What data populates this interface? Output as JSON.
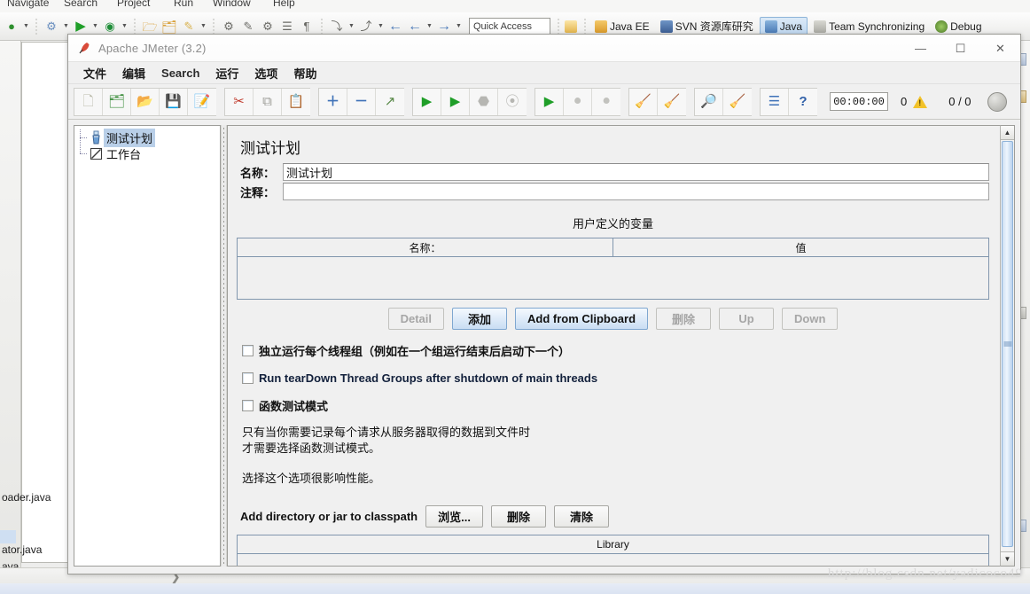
{
  "eclipse": {
    "menubar": [
      {
        "label": "Navigate"
      },
      {
        "label": "Search"
      },
      {
        "label": "Project"
      },
      {
        "label": "Run"
      },
      {
        "label": "Window"
      },
      {
        "label": "Help"
      }
    ],
    "toolbar_icons": [
      {
        "name": "debug-icon",
        "glyph": "⬤"
      },
      {
        "name": "run-icon",
        "glyph": "▶"
      },
      {
        "name": "coverage-icon",
        "glyph": "▶"
      },
      {
        "name": "new-folder-icon",
        "glyph": "🗁"
      },
      {
        "name": "open-folder-icon",
        "glyph": "🗁"
      },
      {
        "name": "edit-pencil-icon",
        "glyph": "✎"
      },
      {
        "name": "pin-icon",
        "glyph": "⚑"
      },
      {
        "name": "brush-icon",
        "glyph": "✒"
      },
      {
        "name": "external-tools-icon",
        "glyph": "⚙"
      },
      {
        "name": "book-icon",
        "glyph": "☰"
      },
      {
        "name": "paragraph-icon",
        "glyph": "¶"
      },
      {
        "name": "next-annotation-icon",
        "glyph": "⤵"
      },
      {
        "name": "previous-annotation-icon",
        "glyph": "⤴"
      },
      {
        "name": "back-icon",
        "glyph": "←"
      },
      {
        "name": "backward-icon",
        "glyph": "←"
      },
      {
        "name": "forward-icon",
        "glyph": "→"
      }
    ],
    "quick_access": {
      "placeholder": "Quick Access",
      "value": "Quick Access"
    },
    "perspectives": [
      {
        "label": "Java EE",
        "icon": "java-ee-icon",
        "active": false
      },
      {
        "label": "SVN 资源库研究",
        "icon": "svn-repository-icon",
        "active": false
      },
      {
        "label": "Java",
        "icon": "java-icon",
        "active": true
      },
      {
        "label": "Team Synchronizing",
        "icon": "team-sync-icon",
        "active": false
      },
      {
        "label": "Debug",
        "icon": "debug-perspective-icon",
        "active": false
      }
    ],
    "background_files": [
      {
        "label": "oader.java"
      },
      {
        "label": "ator.java"
      },
      {
        "label": "ava"
      }
    ]
  },
  "jmeter": {
    "window": {
      "title": "Apache JMeter (3.2)",
      "minimize_label": "—",
      "maximize_label": "☐",
      "close_label": "✕"
    },
    "menus": [
      {
        "label": "文件",
        "name": "menu-file"
      },
      {
        "label": "编辑",
        "name": "menu-edit"
      },
      {
        "label": "Search",
        "name": "menu-search"
      },
      {
        "label": "运行",
        "name": "menu-run"
      },
      {
        "label": "选项",
        "name": "menu-options"
      },
      {
        "label": "帮助",
        "name": "menu-help"
      }
    ],
    "toolbar": {
      "groups": [
        {
          "buttons": [
            {
              "name": "new-test-plan-icon",
              "glyph": "🗋",
              "color": "#c9c9b8"
            },
            {
              "name": "templates-icon",
              "glyph": "🗂",
              "color": "#4f9e4f"
            },
            {
              "name": "open-icon",
              "glyph": "📂",
              "color": "#d9a13b"
            },
            {
              "name": "save-icon",
              "glyph": "💾",
              "color": "#3b3b3b"
            },
            {
              "name": "save-as-icon",
              "glyph": "📝",
              "color": "#4a4a4a"
            }
          ]
        },
        {
          "buttons": [
            {
              "name": "cut-icon",
              "glyph": "✂",
              "color": "#c23b2e"
            },
            {
              "name": "copy-icon",
              "glyph": "⧉",
              "color": "#8a8a84"
            },
            {
              "name": "paste-icon",
              "glyph": "📋",
              "color": "#c09a44"
            }
          ]
        },
        {
          "buttons": [
            {
              "name": "expand-all-icon",
              "glyph": "＋",
              "color": "#3f72b8"
            },
            {
              "name": "collapse-all-icon",
              "glyph": "－",
              "color": "#3f72b8"
            },
            {
              "name": "toggle-icon",
              "glyph": "↗",
              "color": "#5a8a4a"
            }
          ]
        },
        {
          "buttons": [
            {
              "name": "start-icon",
              "glyph": "▶",
              "color": "#1f9e28"
            },
            {
              "name": "start-no-pauses-icon",
              "glyph": "▶",
              "color": "#1f9e28"
            },
            {
              "name": "stop-icon",
              "glyph": "⬣",
              "color": "#b6b6b2"
            },
            {
              "name": "shutdown-icon",
              "glyph": "⊗",
              "color": "#b6b6b2"
            }
          ]
        },
        {
          "buttons": [
            {
              "name": "remote-start-all-icon",
              "glyph": "▶",
              "color": "#1f9e28"
            },
            {
              "name": "remote-stop-all-icon",
              "glyph": "⚫",
              "color": "#b9b9b5"
            },
            {
              "name": "remote-shutdown-all-icon",
              "glyph": "⚫",
              "color": "#b9b9b5"
            }
          ]
        },
        {
          "buttons": [
            {
              "name": "clear-icon",
              "glyph": "🧹",
              "color": "#b08a3e"
            },
            {
              "name": "clear-all-icon",
              "glyph": "🧹",
              "color": "#b08a3e"
            }
          ]
        },
        {
          "buttons": [
            {
              "name": "search-icon",
              "glyph": "🔎",
              "color": "#3a3a38"
            },
            {
              "name": "search-reset-icon",
              "glyph": "🧹",
              "color": "#d6b330"
            }
          ]
        },
        {
          "buttons": [
            {
              "name": "function-helper-icon",
              "glyph": "☰",
              "color": "#3f72b8"
            },
            {
              "name": "help-icon",
              "glyph": "?",
              "color": "#2f5fa8"
            }
          ]
        }
      ],
      "elapsed_time": "00:00:00",
      "warning_count": "0",
      "warning_icon": "warning-triangle-icon",
      "thread_count": "0 / 0",
      "disabled_circle_icon": "remote-engines-icon"
    },
    "tree": {
      "nodes": [
        {
          "label": "测试计划",
          "icon": "test-plan-icon",
          "selected": true
        },
        {
          "label": "工作台",
          "icon": "workbench-icon",
          "selected": false
        }
      ]
    },
    "main": {
      "panel_title": "测试计划",
      "name_label": "名称：",
      "name_value": "测试计划",
      "comment_label": "注释：",
      "comment_value": "",
      "udv_title": "用户定义的变量",
      "udv_columns": [
        "名称：",
        "值"
      ],
      "udv_rows": [],
      "buttons": [
        {
          "label": "Detail",
          "name": "detail-button",
          "state": "disabled"
        },
        {
          "label": "添加",
          "name": "add-button",
          "state": "primary"
        },
        {
          "label": "Add from Clipboard",
          "name": "add-from-clipboard-button",
          "state": "primary"
        },
        {
          "label": "删除",
          "name": "delete-button",
          "state": "disabled"
        },
        {
          "label": "Up",
          "name": "up-button",
          "state": "disabled"
        },
        {
          "label": "Down",
          "name": "down-button",
          "state": "disabled"
        }
      ],
      "checkboxes": [
        {
          "label": "独立运行每个线程组（例如在一个组运行结束后启动下一个）",
          "name": "serialize-thread-groups-checkbox",
          "checked": false,
          "latin": false
        },
        {
          "label": "Run tearDown Thread Groups after shutdown of main threads",
          "name": "run-teardown-checkbox",
          "checked": false,
          "latin": true
        },
        {
          "label": "函数测试模式",
          "name": "functional-test-mode-checkbox",
          "checked": false,
          "latin": false
        }
      ],
      "note_line1": "只有当你需要记录每个请求从服务器取得的数据到文件时",
      "note_line2": "才需要选择函数测试模式。",
      "note_line3": "选择这个选项很影响性能。",
      "classpath_label": "Add directory or jar to classpath",
      "classpath_buttons": [
        {
          "label": "浏览...",
          "name": "browse-button"
        },
        {
          "label": "删除",
          "name": "classpath-delete-button"
        },
        {
          "label": "清除",
          "name": "classpath-clear-button"
        }
      ],
      "library_column": "Library",
      "library_rows": []
    },
    "scrollbar": {
      "up_arrow": "▲",
      "down_arrow": "▼"
    }
  },
  "watermark": "http://blog.csdn.net/yadicoco49"
}
